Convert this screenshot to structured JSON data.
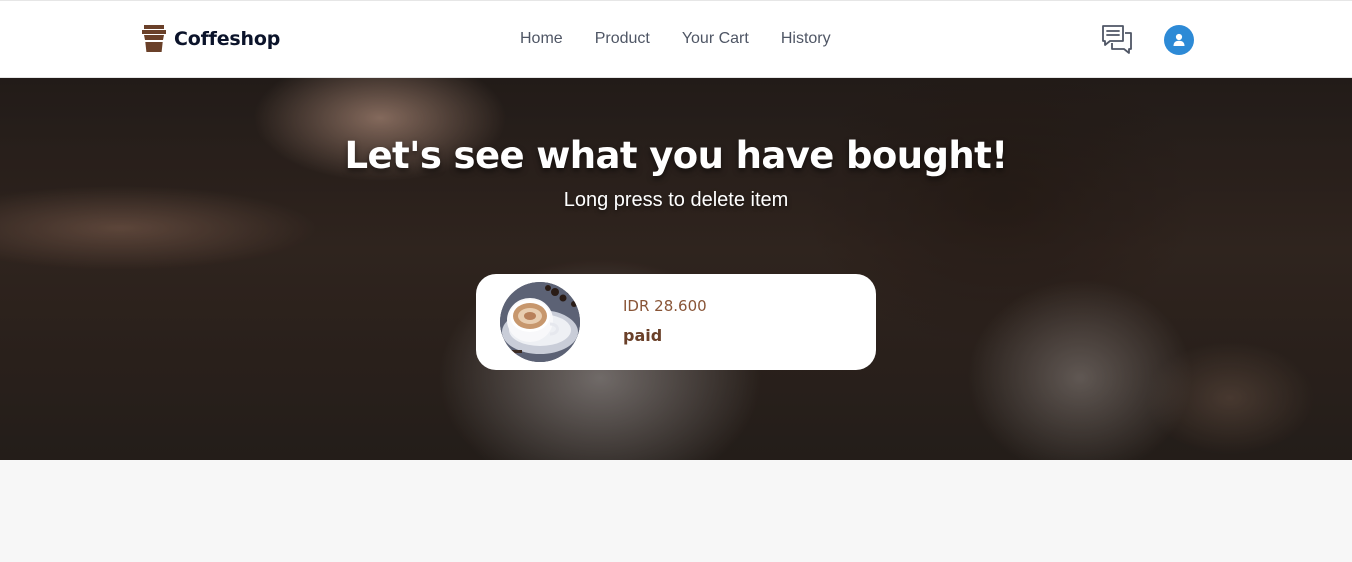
{
  "brand": {
    "name": "Coffeshop",
    "icon": "coffee-cup-icon",
    "color": "#6a4029"
  },
  "nav": {
    "links": [
      {
        "label": "Home"
      },
      {
        "label": "Product"
      },
      {
        "label": "Your Cart"
      },
      {
        "label": "History"
      }
    ]
  },
  "header_icons": {
    "chat": "chat-icon",
    "profile": "user-icon",
    "profile_color": "#2d8ad6"
  },
  "hero": {
    "title": "Let's see what you have bought!",
    "subtitle": "Long press to delete item"
  },
  "history": {
    "items": [
      {
        "price": "IDR 28.600",
        "status": "paid",
        "image": "cappuccino-cup"
      }
    ]
  },
  "colors": {
    "price": "#895537",
    "status": "#6a4029",
    "nav_text": "#4f5665",
    "brand_text": "#0b132a"
  }
}
